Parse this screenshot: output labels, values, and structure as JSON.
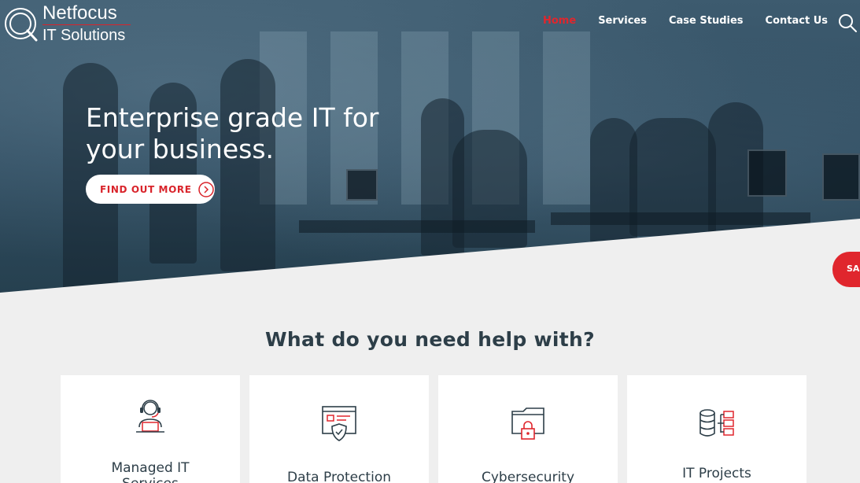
{
  "brand": {
    "line1": "Netfocus",
    "line2": "IT Solutions"
  },
  "nav": {
    "items": [
      {
        "label": "Home",
        "active": true
      },
      {
        "label": "Services"
      },
      {
        "label": "Case Studies"
      },
      {
        "label": "Contact Us"
      }
    ],
    "search_icon": "search-icon"
  },
  "hero": {
    "title_line1": "Enterprise grade IT for",
    "title_line2": "your business.",
    "cta_label": "FIND OUT MORE",
    "side_tab_label": "SA"
  },
  "services": {
    "heading": "What do you need help with?",
    "cards": [
      {
        "label_line1": "Managed IT",
        "label_line2": "Services",
        "icon": "support-agent-icon"
      },
      {
        "label_line1": "Data Protection",
        "label_line2": "",
        "icon": "browser-shield-icon"
      },
      {
        "label_line1": "Cybersecurity",
        "label_line2": "",
        "icon": "folder-lock-icon"
      },
      {
        "label_line1": "IT Projects",
        "label_line2": "",
        "icon": "database-network-icon"
      }
    ]
  },
  "colors": {
    "accent": "#e0262d",
    "text": "#2d3e48",
    "hero": "#2f4c60"
  }
}
